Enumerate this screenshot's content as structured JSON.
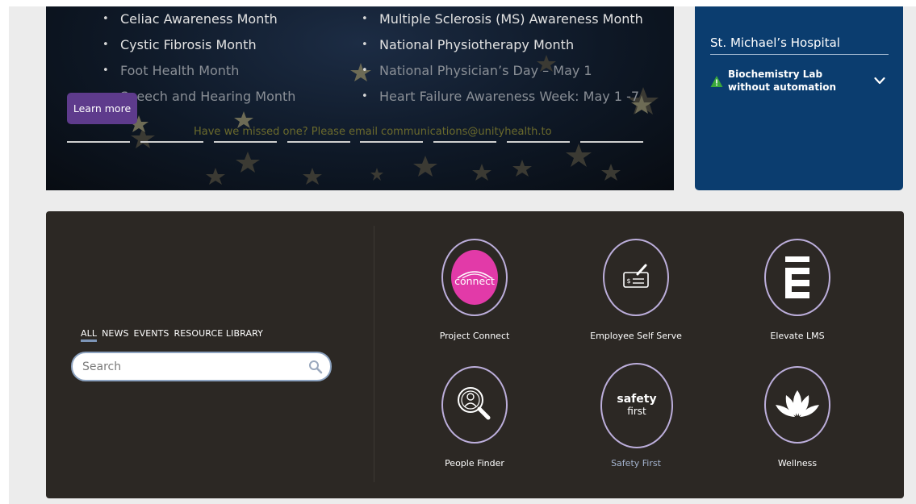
{
  "banner": {
    "list_left": [
      {
        "label": "Celiac Awareness Month"
      },
      {
        "label": "Cystic Fibrosis Month"
      },
      {
        "label": "Foot Health Month"
      },
      {
        "label": "Speech and Hearing Month"
      }
    ],
    "list_right": [
      {
        "label": "Multiple Sclerosis (MS) Awareness Month"
      },
      {
        "label": "National Physiotherapy Month"
      },
      {
        "label": "National Physician’s Day – May 1"
      },
      {
        "label": "Heart Failure Awareness Week: May 1 -7"
      }
    ],
    "learn_more_label": "Learn more",
    "missed_text": "Have we missed one? Please email communications@unityhealth.to"
  },
  "alerts": {
    "hospital": "St. Michael’s Hospital",
    "alert_text": "Biochemistry Lab without automation",
    "warning_color": "#3aa83a"
  },
  "search": {
    "filters": [
      "ALL",
      "NEWS",
      "EVENTS",
      "RESOURCE LIBRARY"
    ],
    "active_filter": "ALL",
    "placeholder": "Search"
  },
  "tools": [
    {
      "label": "Project Connect",
      "icon": "connect-logo-icon",
      "logo_text": "connect"
    },
    {
      "label": "Employee Self Serve",
      "icon": "cheque-pen-icon"
    },
    {
      "label": "Elevate LMS",
      "icon": "elevate-e-icon"
    },
    {
      "label": "People Finder",
      "icon": "person-magnifier-icon"
    },
    {
      "label": "Safety First",
      "icon": "safety-first-icon",
      "logo_line1": "safety",
      "logo_line2": "first"
    },
    {
      "label": "Wellness",
      "icon": "lotus-icon"
    }
  ],
  "colors": {
    "accent_purple": "#5e3b8c",
    "navy": "#0b3d6f",
    "panel_dark": "#2c2824",
    "connect_pink": "#e23aa8"
  }
}
